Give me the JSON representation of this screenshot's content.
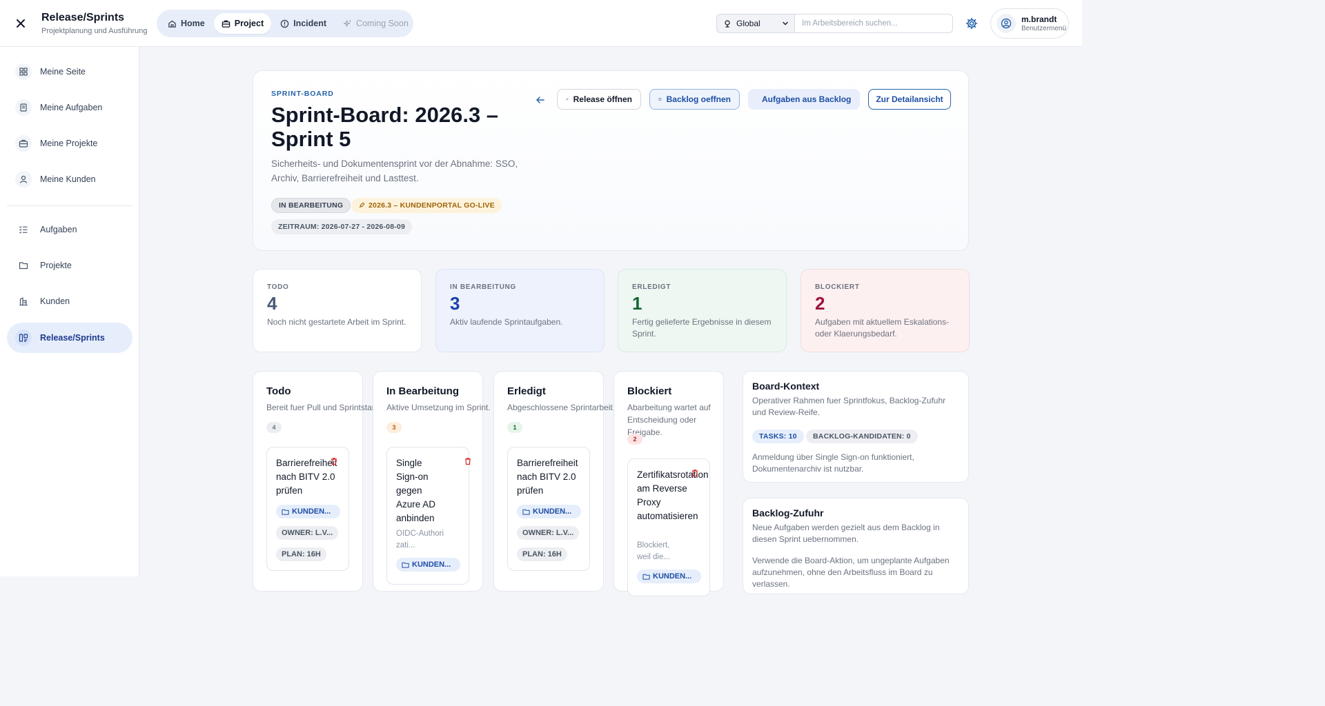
{
  "app": {
    "title": "Release/Sprints",
    "subtitle": "Projektplanung und Ausführung"
  },
  "topnav": [
    {
      "label": "Home",
      "icon": "home-icon"
    },
    {
      "label": "Project",
      "icon": "briefcase-icon",
      "active": true
    },
    {
      "label": "Incident",
      "icon": "alert-icon"
    },
    {
      "label": "Coming Soon",
      "icon": "sparkle-icon",
      "disabled": true
    }
  ],
  "scope": {
    "value": "Global"
  },
  "search": {
    "placeholder": "Im Arbeitsbereich suchen..."
  },
  "user": {
    "name": "m.brandt",
    "menu_label": "Benutzermenü"
  },
  "sidebar": {
    "items": [
      {
        "label": "Meine Seite",
        "icon": "dashboard-icon"
      },
      {
        "label": "Meine Aufgaben",
        "icon": "task-clipboard-icon"
      },
      {
        "label": "Meine Projekte",
        "icon": "briefcase-icon"
      },
      {
        "label": "Meine Kunden",
        "icon": "user-icon"
      },
      {
        "label": "Aufgaben",
        "icon": "checklist-icon"
      },
      {
        "label": "Projekte",
        "icon": "folder-icon"
      },
      {
        "label": "Kunden",
        "icon": "building-icon"
      },
      {
        "label": "Release/Sprints",
        "icon": "board-icon",
        "active": true
      }
    ]
  },
  "header": {
    "kicker": "SPRINT-BOARD",
    "title": "Sprint-Board: 2026.3 – Sprint 5",
    "description": "Sicherheits- und Dokumentensprint vor der Abnahme: SSO, Archiv, Barrierefreiheit und Lasttest.",
    "status_chip": "IN BEARBEITUNG",
    "release_chip": "2026.3 – KUNDENPORTAL GO-LIVE",
    "range_chip": "ZEITRAUM: 2026-07-27 - 2026-08-09",
    "buttons": {
      "release": "Release öffnen",
      "backlog": "Backlog oeffnen",
      "add": "Aufgaben aus Backlog",
      "detail": "Zur Detailansicht"
    }
  },
  "stats": [
    {
      "label": "TODO",
      "value": "4",
      "desc": "Noch nicht gestartete Arbeit im Sprint."
    },
    {
      "label": "IN BEARBEITUNG",
      "value": "3",
      "desc": "Aktiv laufende Sprintaufgaben."
    },
    {
      "label": "ERLEDIGT",
      "value": "1",
      "desc": "Fertig gelieferte Ergebnisse in diesem Sprint."
    },
    {
      "label": "BLOCKIERT",
      "value": "2",
      "desc": "Aufgaben mit aktuellem Eskalations- oder Klaerungsbedarf."
    }
  ],
  "columns": [
    {
      "title": "Todo",
      "desc": "Bereit fuer Pull und Sprintstart.",
      "count": "4",
      "task": {
        "title": "Barrierefreiheit nach BITV 2.0 prüfen",
        "tag": "KUNDEN...",
        "owner": "OWNER: L.V...",
        "plan": "PLAN: 16H"
      }
    },
    {
      "title": "In Bearbeitung",
      "desc": "Aktive Umsetzung im Sprint.",
      "count": "3",
      "task": {
        "title": "Single Sign-on gegen Azure AD anbinden",
        "sub": "OIDC-Authorizati...",
        "tag": "KUNDEN..."
      }
    },
    {
      "title": "Erledigt",
      "desc": "Abgeschlossene Sprintarbeit.",
      "count": "1",
      "task": {
        "title": "Barrierefreiheit nach BITV 2.0 prüfen",
        "tag": "KUNDEN...",
        "owner": "OWNER: L.V...",
        "plan": "PLAN: 16H"
      }
    },
    {
      "title": "Blockiert",
      "desc": "Abarbeitung wartet auf Entscheidung oder Freigabe.",
      "count": "2",
      "task": {
        "title": "Zertifikatsrotation am Reverse Proxy automatisieren",
        "sub": "Blockiert, weil die...",
        "tag": "KUNDEN..."
      }
    }
  ],
  "context": {
    "board": {
      "title": "Board-Kontext",
      "text": "Operativer Rahmen fuer Sprintfokus, Backlog-Zufuhr und Review-Reife.",
      "chip_tasks": "TASKS: 10",
      "chip_backlog": "BACKLOG-KANDIDATEN: 0",
      "note": "Anmeldung über Single Sign-on funktioniert, Dokumentenarchiv ist nutzbar."
    },
    "backlog": {
      "title": "Backlog-Zufuhr",
      "text": "Neue Aufgaben werden gezielt aus dem Backlog in diesen Sprint uebernommen.",
      "note": "Verwende die Board-Aktion, um ungeplante Aufgaben aufzunehmen, ohne den Arbeitsfluss im Board zu verlassen."
    }
  },
  "colors": {
    "accent": "#1d4ea3",
    "todo": "#4a5a78",
    "in_progress": "#1e40af",
    "done": "#166534",
    "blocked": "#9f1239"
  }
}
